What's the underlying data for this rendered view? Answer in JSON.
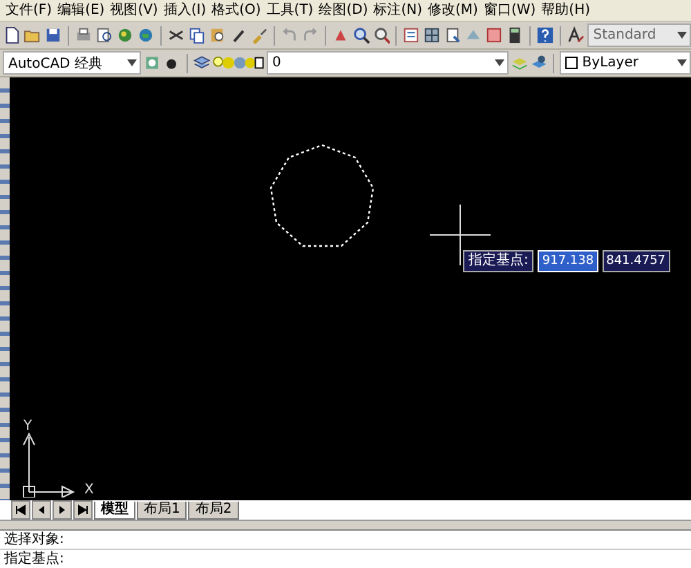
{
  "menu": [
    "文件(F)",
    "编辑(E)",
    "视图(V)",
    "插入(I)",
    "格式(O)",
    "工具(T)",
    "绘图(D)",
    "标注(N)",
    "修改(M)",
    "窗口(W)",
    "帮助(H)"
  ],
  "workspace": {
    "value": "AutoCAD 经典"
  },
  "text_style": {
    "value": "Standard"
  },
  "layer": {
    "value": "0"
  },
  "color": {
    "value": "ByLayer"
  },
  "canvas": {
    "prompt": {
      "label": "指定基点:",
      "x_value": "917.138",
      "y_value": "841.4757"
    },
    "axis_x": "X",
    "axis_y": "Y"
  },
  "layout_tabs": [
    {
      "label": "模型",
      "selected": true
    },
    {
      "label": "布局1",
      "selected": false
    },
    {
      "label": "布局2",
      "selected": false
    }
  ],
  "command_lines": [
    "选择对象:",
    "指定基点:"
  ]
}
